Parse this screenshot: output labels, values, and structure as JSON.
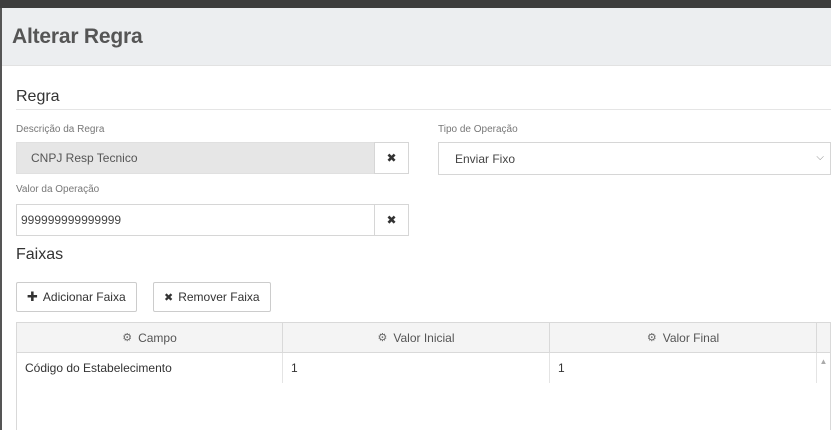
{
  "modal": {
    "title": "Alterar Regra"
  },
  "regra": {
    "section_title": "Regra",
    "descricao_label": "Descrição da Regra",
    "descricao_value": "CNPJ Resp Tecnico",
    "tipo_label": "Tipo de Operação",
    "tipo_value": "Enviar Fixo",
    "valor_label": "Valor da Operação",
    "valor_value": "999999999999999"
  },
  "faixas": {
    "section_title": "Faixas",
    "add_label": "Adicionar Faixa",
    "remove_label": "Remover Faixa",
    "columns": [
      "Campo",
      "Valor Inicial",
      "Valor Final"
    ],
    "rows": [
      [
        "Código do Estabelecimento",
        "1",
        "1"
      ]
    ]
  },
  "icons": {
    "clear": "times-icon",
    "plus": "plus-icon",
    "gear": "gear-icon",
    "caret": "chevron-down-icon"
  }
}
